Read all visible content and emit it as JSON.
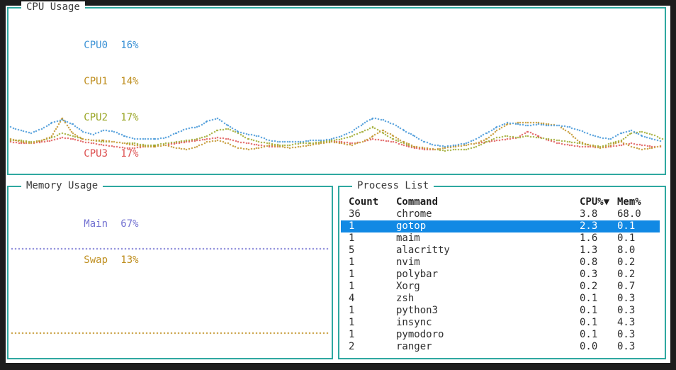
{
  "theme": {
    "screen_bg": "#1d1d1d",
    "panel_bg": "#ffffff",
    "border": "#2fa8a0",
    "text": "#2e2e2e",
    "selected_bg": "#1189e4",
    "selected_fg": "#ffffff"
  },
  "cpu": {
    "title": "CPU Usage",
    "legend": [
      {
        "label": "CPU0",
        "value": "16%",
        "color": "#3d93d6"
      },
      {
        "label": "CPU1",
        "value": "14%",
        "color": "#bf8f20"
      },
      {
        "label": "CPU2",
        "value": "17%",
        "color": "#9aa626"
      },
      {
        "label": "CPU3",
        "value": "17%",
        "color": "#dd5050"
      }
    ],
    "chart": {
      "type": "line",
      "ylim": [
        0,
        100
      ],
      "series": [
        {
          "name": "CPU0",
          "color": "#3d93d6",
          "values": [
            28,
            26,
            24,
            27,
            31,
            33,
            30,
            25,
            23,
            26,
            25,
            22,
            20,
            20,
            20,
            21,
            24,
            27,
            28,
            32,
            34,
            29,
            25,
            23,
            22,
            19,
            18,
            18,
            18,
            19,
            19,
            20,
            22,
            25,
            30,
            34,
            33,
            30,
            26,
            22,
            18,
            16,
            15,
            16,
            17,
            20,
            24,
            28,
            31,
            30,
            29,
            30,
            29,
            29,
            28,
            26,
            23,
            21,
            20,
            24,
            26,
            22,
            20,
            18
          ]
        },
        {
          "name": "CPU1",
          "color": "#bf8f20",
          "values": [
            20,
            18,
            17,
            19,
            22,
            34,
            24,
            20,
            19,
            19,
            18,
            17,
            16,
            15,
            15,
            16,
            14,
            13,
            15,
            18,
            19,
            17,
            14,
            13,
            14,
            16,
            15,
            14,
            15,
            16,
            17,
            18,
            17,
            16,
            18,
            22,
            26,
            22,
            18,
            15,
            14,
            13,
            14,
            15,
            16,
            17,
            20,
            26,
            30,
            31,
            31,
            31,
            30,
            29,
            24,
            18,
            16,
            14,
            16,
            18,
            15,
            13,
            14,
            16
          ]
        },
        {
          "name": "CPU2",
          "color": "#9aa626",
          "values": [
            19,
            19,
            18,
            19,
            21,
            24,
            22,
            20,
            19,
            18,
            18,
            17,
            17,
            16,
            16,
            17,
            18,
            19,
            20,
            22,
            26,
            27,
            24,
            20,
            18,
            17,
            16,
            16,
            17,
            17,
            18,
            19,
            20,
            22,
            25,
            28,
            24,
            20,
            17,
            15,
            14,
            13,
            12,
            13,
            13,
            15,
            18,
            21,
            22,
            21,
            22,
            21,
            20,
            19,
            18,
            17,
            16,
            15,
            17,
            19,
            24,
            25,
            23,
            20
          ]
        },
        {
          "name": "CPU3",
          "color": "#dd5050",
          "values": [
            18,
            17,
            17,
            18,
            19,
            21,
            20,
            18,
            17,
            16,
            15,
            14,
            14,
            15,
            15,
            16,
            17,
            18,
            19,
            20,
            21,
            20,
            18,
            17,
            16,
            15,
            15,
            14,
            15,
            16,
            17,
            18,
            18,
            17,
            18,
            20,
            19,
            18,
            16,
            14,
            13,
            13,
            14,
            15,
            16,
            17,
            18,
            19,
            20,
            21,
            25,
            22,
            19,
            17,
            16,
            15,
            15,
            14,
            15,
            16,
            17,
            16,
            15,
            15
          ]
        }
      ]
    }
  },
  "memory": {
    "title": "Memory Usage",
    "legend": [
      {
        "label": "Main",
        "value": "67%",
        "color": "#7473d2"
      },
      {
        "label": "Swap",
        "value": "13%",
        "color": "#bf8f20"
      }
    ],
    "chart": {
      "type": "line",
      "ylim": [
        0,
        100
      ],
      "lines": [
        {
          "name": "Main",
          "value": 67,
          "color": "#7473d2"
        },
        {
          "name": "Swap",
          "value": 13,
          "color": "#bf8f20"
        }
      ]
    }
  },
  "processes": {
    "title": "Process List",
    "columns": [
      "Count",
      "Command",
      "CPU%▼",
      "Mem%"
    ],
    "selected_index": 1,
    "rows": [
      {
        "count": "36",
        "command": "chrome",
        "cpu": "3.8",
        "mem": "68.0"
      },
      {
        "count": "1",
        "command": "gotop",
        "cpu": "2.3",
        "mem": "0.1"
      },
      {
        "count": "1",
        "command": "maim",
        "cpu": "1.6",
        "mem": "0.1"
      },
      {
        "count": "5",
        "command": "alacritty",
        "cpu": "1.3",
        "mem": "8.0"
      },
      {
        "count": "1",
        "command": "nvim",
        "cpu": "0.8",
        "mem": "0.2"
      },
      {
        "count": "1",
        "command": "polybar",
        "cpu": "0.3",
        "mem": "0.2"
      },
      {
        "count": "1",
        "command": "Xorg",
        "cpu": "0.2",
        "mem": "0.7"
      },
      {
        "count": "4",
        "command": "zsh",
        "cpu": "0.1",
        "mem": "0.3"
      },
      {
        "count": "1",
        "command": "python3",
        "cpu": "0.1",
        "mem": "0.3"
      },
      {
        "count": "1",
        "command": "insync",
        "cpu": "0.1",
        "mem": "4.3"
      },
      {
        "count": "1",
        "command": "pymodoro",
        "cpu": "0.1",
        "mem": "0.3"
      },
      {
        "count": "2",
        "command": "ranger",
        "cpu": "0.0",
        "mem": "0.3"
      }
    ]
  }
}
